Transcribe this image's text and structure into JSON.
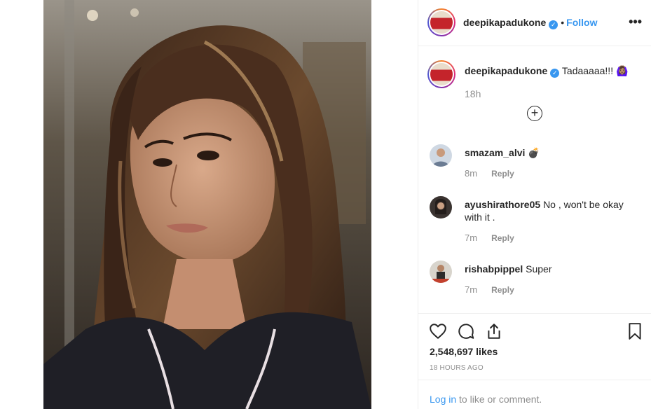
{
  "post": {
    "author": "deepikapadukone",
    "follow_label": "Follow",
    "separator": "•",
    "more_label": "•••",
    "caption": {
      "username": "deepikapadukone",
      "text": "Tadaaaaa!!! 🙆🏽‍♀️",
      "time": "18h"
    },
    "load_more_label": "+"
  },
  "comments": [
    {
      "username": "smazam_alvi",
      "text": "💣",
      "time": "8m",
      "reply_label": "Reply"
    },
    {
      "username": "ayushirathore05",
      "text": "No , won't be okay with it .",
      "time": "7m",
      "reply_label": "Reply"
    },
    {
      "username": "rishabpippel",
      "text": "Super",
      "time": "7m",
      "reply_label": "Reply"
    }
  ],
  "actions": {
    "likes": "2,548,697 likes",
    "posted": "18 HOURS AGO",
    "icons": [
      "heart-icon",
      "comment-icon",
      "share-icon",
      "bookmark-icon"
    ]
  },
  "login_bar": {
    "login_label": "Log in",
    "rest": "to like or comment."
  },
  "colors": {
    "accent": "#3897f0",
    "muted": "#8e8e8e",
    "text": "#262626",
    "border": "#efefef"
  }
}
